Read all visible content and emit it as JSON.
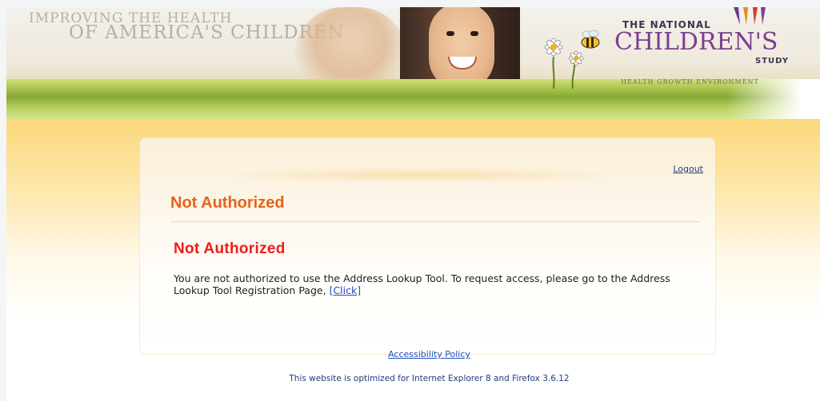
{
  "header": {
    "tagline_line1": "IMPROVING THE HEALTH",
    "tagline_line2": "OF AMERICA'S CHILDREN",
    "logo": {
      "the_national": "THE NATIONAL",
      "childrens": "CHILDREN'S",
      "study": "STUDY",
      "subline": "HEALTH   GROWTH   ENVIRONMENT"
    }
  },
  "card": {
    "logout_label": "Logout",
    "title": "Not Authorized",
    "message_heading": "Not Authorized",
    "message_text": "You are not authorized to use the Address Lookup Tool. To request access, please go to the Address Lookup Tool Registration Page,",
    "message_link": "[Click]"
  },
  "footer": {
    "accessibility_label": "Accessibility Policy",
    "note": "This website is optimized for Internet Explorer 8 and Firefox 3.6.12"
  },
  "colors": {
    "title_orange": "#e5641a",
    "error_red": "#ee1b1b",
    "link_blue": "#1f4fc1",
    "brand_purple": "#7a3f8f"
  }
}
